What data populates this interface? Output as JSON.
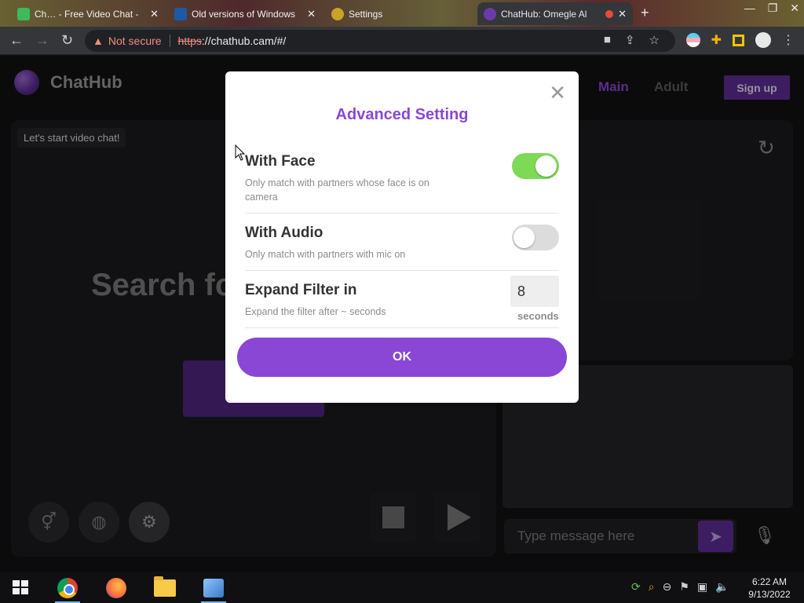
{
  "browser": {
    "tabs": [
      {
        "title": "Ch… - Free Video Chat -",
        "favicon_color": "#3dbb5a"
      },
      {
        "title": "Old versions of Windows",
        "favicon_color": "#1a5aa6"
      },
      {
        "title": "Settings",
        "favicon_color": "#c9a227"
      },
      {
        "title": "ChatHub: Omegle Al",
        "favicon_color": "#e64a3b"
      }
    ],
    "security_label": "Not secure",
    "url_scheme": "https",
    "url_rest": "://chathub.cam/#/"
  },
  "site": {
    "brand": "ChatHub",
    "nav_main": "Main",
    "nav_adult": "Adult",
    "signup": "Sign up",
    "start_label": "Let's start video chat!",
    "search_heading": "Search fo",
    "chat_placeholder": "Type message here"
  },
  "modal": {
    "title": "Advanced Setting",
    "settings": [
      {
        "heading": "With Face",
        "description": "Only match with partners whose face is on camera",
        "enabled": true
      },
      {
        "heading": "With Audio",
        "description": "Only match with partners with mic on",
        "enabled": false
      }
    ],
    "expand": {
      "heading": "Expand Filter in",
      "description": "Expand the filter after ~ seconds",
      "value": "8",
      "unit": "seconds"
    },
    "ok": "OK"
  },
  "taskbar": {
    "time": "6:22 AM",
    "date": "9/13/2022"
  }
}
